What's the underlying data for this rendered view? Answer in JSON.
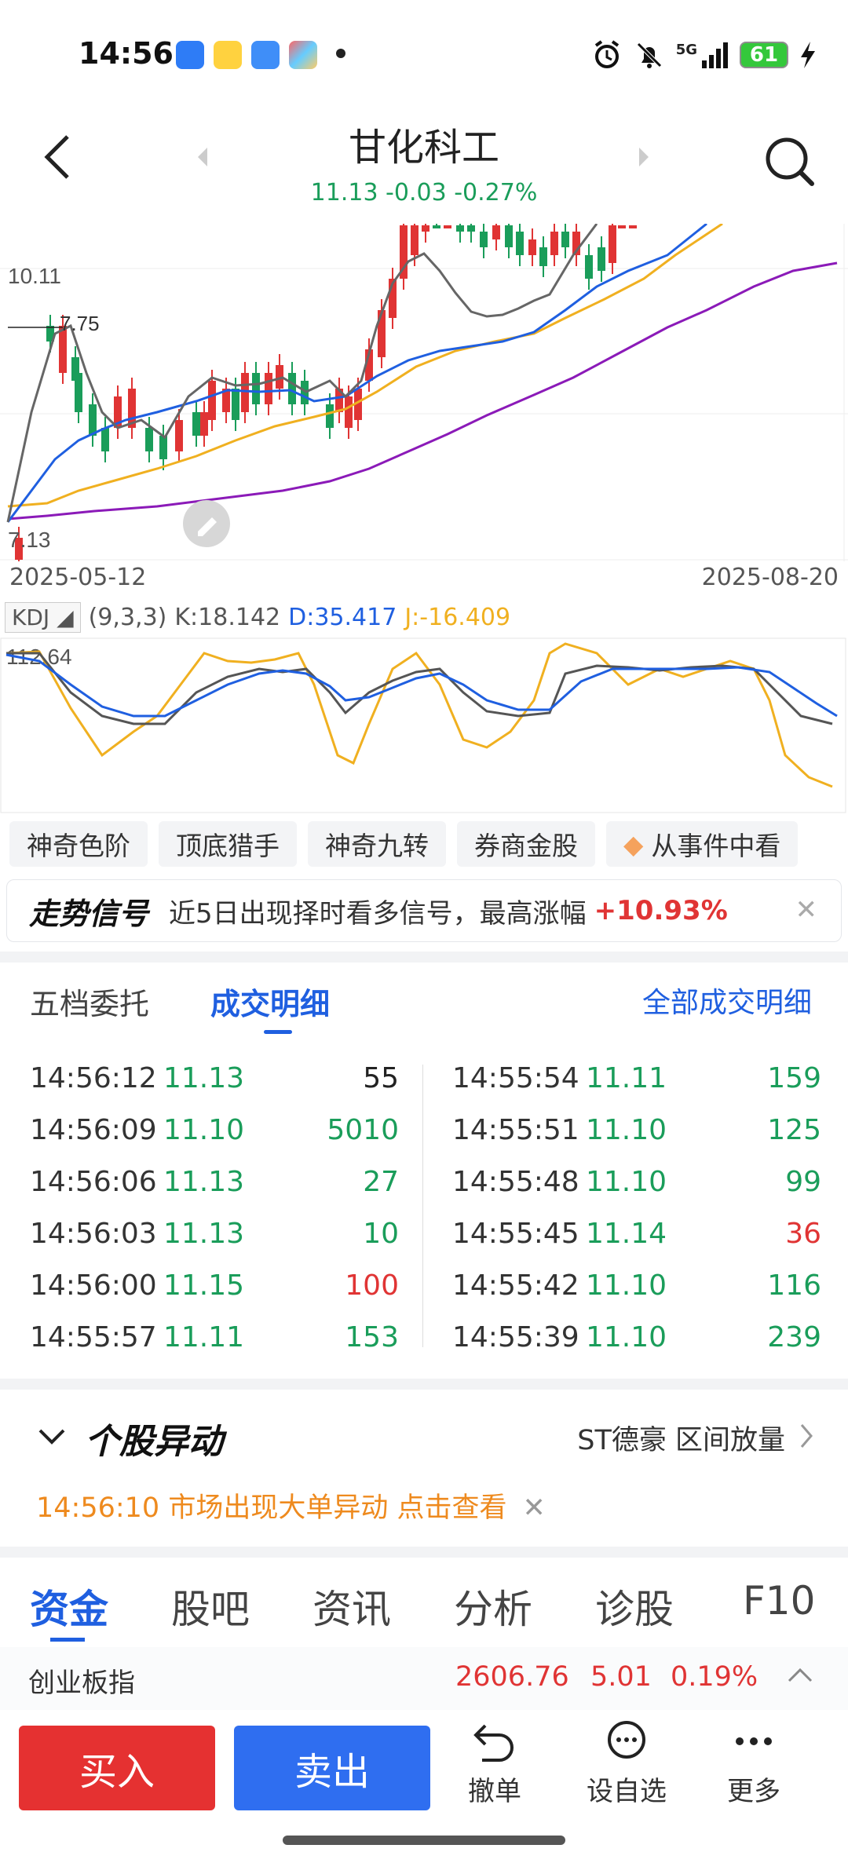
{
  "status": {
    "time": "14:56",
    "network": "5G",
    "battery": "61"
  },
  "header": {
    "title": "甘化科工",
    "quote": "11.13 -0.03 -0.27%"
  },
  "kline": {
    "price_top": "10.11",
    "price_low_mark": "7.75",
    "price_bottom": "7.13",
    "date_start": "2025-05-12",
    "date_end": "2025-08-20"
  },
  "kdj": {
    "name": "KDJ",
    "params": "(9,3,3)",
    "k": "K:18.142",
    "d": "D:35.417",
    "j": "J:-16.409",
    "axis_top": "112.64",
    "colors": {
      "k": "#555555",
      "d": "#1f5fe0",
      "j": "#f0b020"
    }
  },
  "chips": [
    "神奇色阶",
    "顶底猎手",
    "神奇九转",
    "券商金股",
    "从事件中看"
  ],
  "signal": {
    "title": "走势信号",
    "text": "近5日出现择时看多信号，最高涨幅",
    "pct": "+10.93%"
  },
  "trade_tabs": {
    "tab1": "五档委托",
    "tab2": "成交明细",
    "all": "全部成交明细"
  },
  "trades_left": [
    {
      "time": "14:56:12",
      "price": "11.13",
      "vol": "55",
      "color": "#222222",
      "pcolor": "#1a9d5a"
    },
    {
      "time": "14:56:09",
      "price": "11.10",
      "vol": "5010",
      "color": "#1a9d5a",
      "pcolor": "#1a9d5a"
    },
    {
      "time": "14:56:06",
      "price": "11.13",
      "vol": "27",
      "color": "#1a9d5a",
      "pcolor": "#1a9d5a"
    },
    {
      "time": "14:56:03",
      "price": "11.13",
      "vol": "10",
      "color": "#1a9d5a",
      "pcolor": "#1a9d5a"
    },
    {
      "time": "14:56:00",
      "price": "11.15",
      "vol": "100",
      "color": "#e03434",
      "pcolor": "#1a9d5a"
    },
    {
      "time": "14:55:57",
      "price": "11.11",
      "vol": "153",
      "color": "#1a9d5a",
      "pcolor": "#1a9d5a"
    }
  ],
  "trades_right": [
    {
      "time": "14:55:54",
      "price": "11.11",
      "vol": "159",
      "color": "#1a9d5a",
      "pcolor": "#1a9d5a"
    },
    {
      "time": "14:55:51",
      "price": "11.10",
      "vol": "125",
      "color": "#1a9d5a",
      "pcolor": "#1a9d5a"
    },
    {
      "time": "14:55:48",
      "price": "11.10",
      "vol": "99",
      "color": "#1a9d5a",
      "pcolor": "#1a9d5a"
    },
    {
      "time": "14:55:45",
      "price": "11.14",
      "vol": "36",
      "color": "#e03434",
      "pcolor": "#1a9d5a"
    },
    {
      "time": "14:55:42",
      "price": "11.10",
      "vol": "116",
      "color": "#1a9d5a",
      "pcolor": "#1a9d5a"
    },
    {
      "time": "14:55:39",
      "price": "11.10",
      "vol": "239",
      "color": "#1a9d5a",
      "pcolor": "#1a9d5a"
    }
  ],
  "ydg": {
    "title": "个股异动",
    "right": "ST德豪 区间放量",
    "alert": "14:56:10 市场出现大单异动 点击查看"
  },
  "bottom_tabs": [
    "资金",
    "股吧",
    "资讯",
    "分析",
    "诊股",
    "F10"
  ],
  "index": {
    "name": "创业板指",
    "value": "2606.76",
    "change": "5.01",
    "pct": "0.19%"
  },
  "actions": {
    "buy": "买入",
    "sell": "卖出",
    "cancel": "撤单",
    "watch": "设自选",
    "more": "更多"
  }
}
